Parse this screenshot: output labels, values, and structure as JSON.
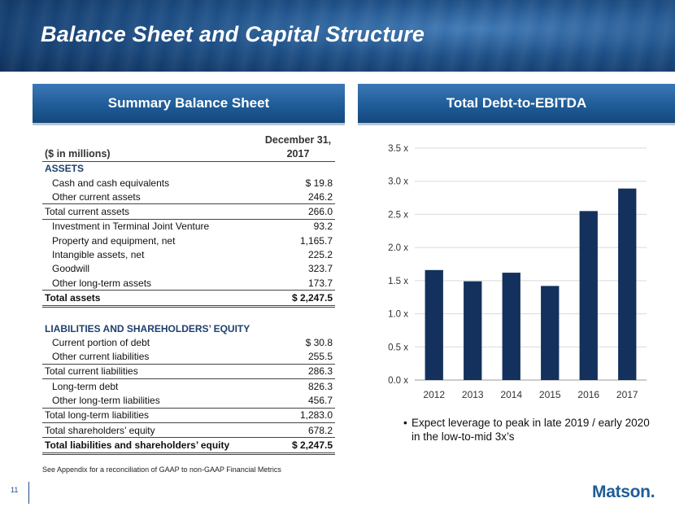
{
  "slide": {
    "title": "Balance Sheet and Capital Structure",
    "page_number": "11",
    "logo": "Matson.",
    "footnote": "See Appendix for a reconciliation of GAAP to non-GAAP Financial Metrics"
  },
  "left_panel": {
    "heading": "Summary Balance Sheet"
  },
  "right_panel": {
    "heading": "Total Debt-to-EBITDA",
    "bullet": "Expect leverage to peak in late 2019 / early 2020 in the low-to-mid 3x’s"
  },
  "balance_sheet": {
    "units_label": "($ in millions)",
    "col_header_1": "December 31,",
    "col_header_2": "2017",
    "assets_heading": "ASSETS",
    "liab_heading": "LIABILITIES AND SHAREHOLDERS’ EQUITY",
    "assets": [
      {
        "label": "Cash and cash equivalents",
        "value": "$ 19.8"
      },
      {
        "label": "Other current assets",
        "value": "246.2"
      },
      {
        "label": "Total current assets",
        "value": "266.0"
      },
      {
        "label": "Investment in Terminal Joint Venture",
        "value": "93.2"
      },
      {
        "label": "Property and equipment, net",
        "value": "1,165.7"
      },
      {
        "label": "Intangible assets, net",
        "value": "225.2"
      },
      {
        "label": "Goodwill",
        "value": "323.7"
      },
      {
        "label": "Other long-term assets",
        "value": "173.7"
      },
      {
        "label": "Total assets",
        "value": "$ 2,247.5"
      }
    ],
    "liabilities": [
      {
        "label": "Current portion of debt",
        "value": "$ 30.8"
      },
      {
        "label": "Other current liabilities",
        "value": "255.5"
      },
      {
        "label": "Total current liabilities",
        "value": "286.3"
      },
      {
        "label": "Long-term debt",
        "value": "826.3"
      },
      {
        "label": "Other long-term liabilities",
        "value": "456.7"
      },
      {
        "label": "Total long-term liabilities",
        "value": "1,283.0"
      },
      {
        "label": "Total shareholders’ equity",
        "value": "678.2"
      },
      {
        "label": "Total liabilities and shareholders’ equity",
        "value": "$ 2,247.5"
      }
    ]
  },
  "chart_data": {
    "type": "bar",
    "categories": [
      "2012",
      "2013",
      "2014",
      "2015",
      "2016",
      "2017"
    ],
    "values": [
      1.66,
      1.49,
      1.62,
      1.42,
      2.55,
      2.89
    ],
    "y_ticks": [
      "0.0 x",
      "0.5 x",
      "1.0 x",
      "1.5 x",
      "2.0 x",
      "2.5 x",
      "3.0 x",
      "3.5 x"
    ],
    "ylim": [
      0,
      3.5
    ],
    "bar_color": "#13315c",
    "title": "",
    "xlabel": "",
    "ylabel": ""
  }
}
